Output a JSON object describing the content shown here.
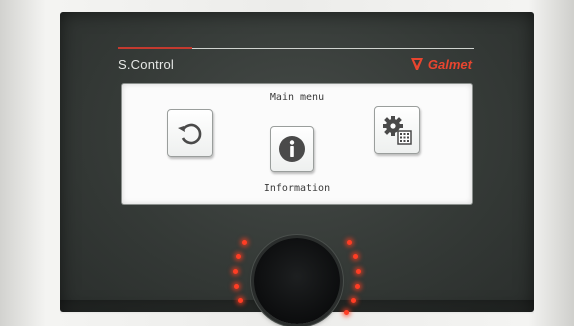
{
  "device": {
    "model_label": "S.Control",
    "brand_label": "Galmet",
    "accent_color": "#c43a2f",
    "brand_color": "#e8452f"
  },
  "screen": {
    "title": "Main menu",
    "selected_item_label": "Information",
    "items": [
      {
        "icon": "return-arrow-icon"
      },
      {
        "icon": "info-icon"
      },
      {
        "icon": "settings-gears-icon"
      }
    ]
  },
  "knob": {
    "led_color": "#ff3d24"
  }
}
